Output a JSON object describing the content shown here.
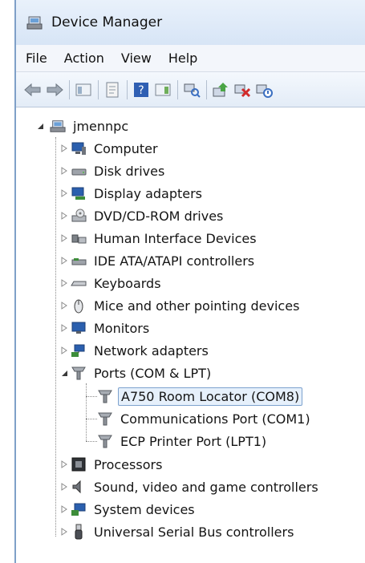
{
  "window": {
    "title": "Device Manager"
  },
  "menu": [
    "File",
    "Action",
    "View",
    "Help"
  ],
  "toolbar": {
    "icons": [
      "back-arrow-icon",
      "forward-arrow-icon",
      "show-hide-console-tree-icon",
      "properties-icon",
      "help-icon",
      "action-pane-icon",
      "scan-hardware-icon",
      "update-driver-icon",
      "uninstall-device-icon",
      "disable-device-icon"
    ]
  },
  "tree": {
    "root": "jmennpc",
    "categories": [
      {
        "label": "Computer",
        "icon": "computer-icon"
      },
      {
        "label": "Disk drives",
        "icon": "disk-drive-icon"
      },
      {
        "label": "Display adapters",
        "icon": "display-adapter-icon"
      },
      {
        "label": "DVD/CD-ROM drives",
        "icon": "dvd-drive-icon"
      },
      {
        "label": "Human Interface Devices",
        "icon": "hid-icon"
      },
      {
        "label": "IDE ATA/ATAPI controllers",
        "icon": "ide-controller-icon"
      },
      {
        "label": "Keyboards",
        "icon": "keyboard-icon"
      },
      {
        "label": "Mice and other pointing devices",
        "icon": "mouse-icon"
      },
      {
        "label": "Monitors",
        "icon": "monitor-icon"
      },
      {
        "label": "Network adapters",
        "icon": "network-adapter-icon"
      },
      {
        "label": "Ports (COM & LPT)",
        "icon": "port-icon",
        "expanded": true,
        "children": [
          {
            "label": "A750 Room Locator (COM8)",
            "selected": true
          },
          {
            "label": "Communications Port (COM1)"
          },
          {
            "label": "ECP Printer Port (LPT1)"
          }
        ]
      },
      {
        "label": "Processors",
        "icon": "processor-icon"
      },
      {
        "label": "Sound, video and game controllers",
        "icon": "sound-icon"
      },
      {
        "label": "System devices",
        "icon": "system-devices-icon"
      },
      {
        "label": "Universal Serial Bus controllers",
        "icon": "usb-icon"
      }
    ]
  }
}
